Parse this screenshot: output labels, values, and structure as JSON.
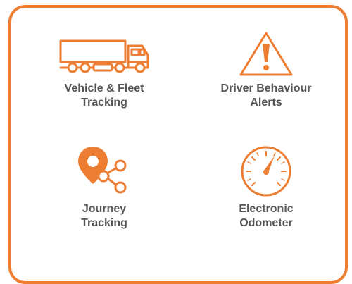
{
  "colors": {
    "accent": "#ed7d31",
    "text": "#555555",
    "background": "#ffffff"
  },
  "features": [
    {
      "icon": "truck-icon",
      "label": "Vehicle & Fleet\nTracking"
    },
    {
      "icon": "warning-icon",
      "label": "Driver Behaviour\nAlerts"
    },
    {
      "icon": "route-pin-icon",
      "label": "Journey\nTracking"
    },
    {
      "icon": "odometer-icon",
      "label": "Electronic\nOdometer"
    }
  ]
}
